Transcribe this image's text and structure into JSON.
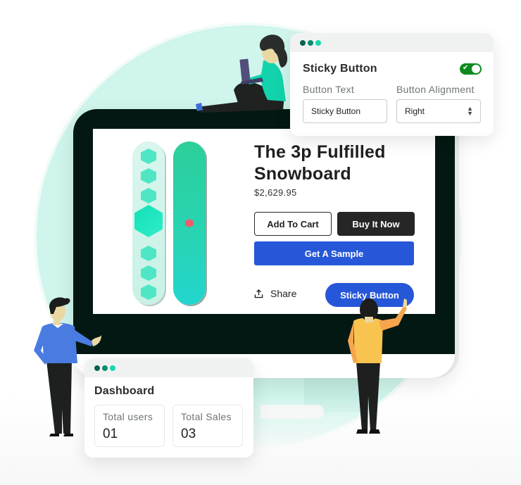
{
  "settings_panel": {
    "window_dots": [
      "dark-green",
      "green",
      "mint"
    ],
    "title": "Sticky Button",
    "toggle_enabled": true,
    "button_text_label": "Button Text",
    "button_text_value": "Sticky Button",
    "button_alignment_label": "Button Alignment",
    "button_alignment_value": "Right"
  },
  "product": {
    "title": "The 3p Fulfilled Snowboard",
    "price": "$2,629.95",
    "add_to_cart_label": "Add To Cart",
    "buy_now_label": "Buy It Now",
    "get_sample_label": "Get A Sample",
    "share_label": "Share",
    "sticky_button_label": "Sticky Button"
  },
  "dashboard": {
    "window_dots": [
      "dark-green",
      "green",
      "mint"
    ],
    "title": "Dashboard",
    "stats": [
      {
        "label": "Total users",
        "value": "01"
      },
      {
        "label": "Total Sales",
        "value": "03"
      }
    ]
  },
  "colors": {
    "accent_blue": "#2657d8",
    "toggle_green": "#0c8a1e",
    "monitor_bezel": "#031813",
    "background_mint": "#cff5ec"
  }
}
